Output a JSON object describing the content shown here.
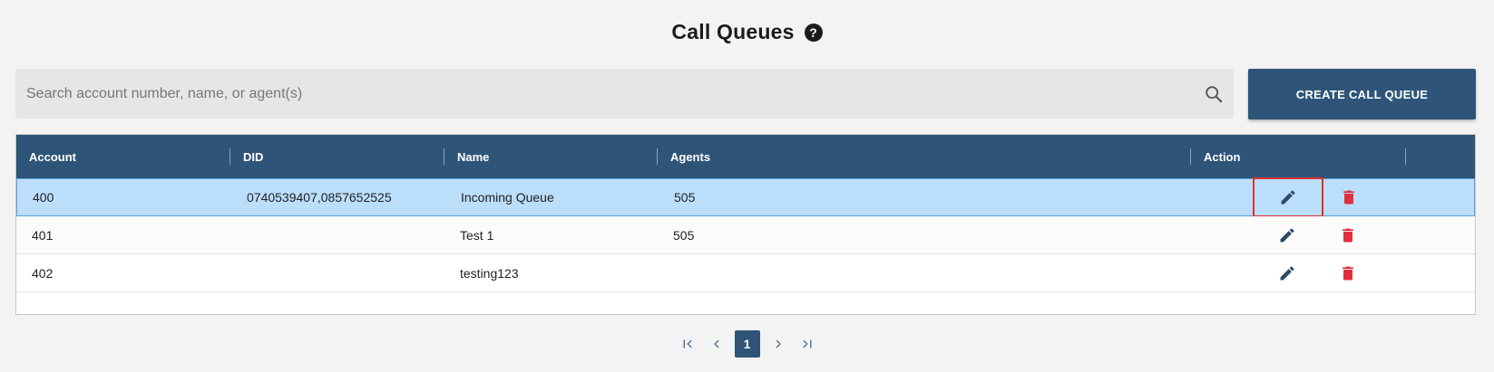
{
  "page": {
    "title": "Call Queues",
    "help_glyph": "?"
  },
  "search": {
    "placeholder": "Search account number, name, or agent(s)",
    "value": "",
    "icon": "search-icon"
  },
  "toolbar": {
    "create_label": "CREATE CALL QUEUE"
  },
  "table": {
    "columns": [
      "Account",
      "DID",
      "Name",
      "Agents",
      "Action"
    ],
    "rows": [
      {
        "account": "400",
        "did": "0740539407,0857652525",
        "name": "Incoming Queue",
        "agents": "505"
      },
      {
        "account": "401",
        "did": "",
        "name": "Test 1",
        "agents": "505"
      },
      {
        "account": "402",
        "did": "",
        "name": "testing123",
        "agents": ""
      }
    ],
    "action_icons": [
      "pencil-icon",
      "trash-icon"
    ]
  },
  "pagination": {
    "current_page": "1"
  },
  "colors": {
    "header_bg": "#2e5578",
    "selected_row": "#bbdefb",
    "delete_red": "#e0303f",
    "focus_outline": "#e0302f"
  }
}
